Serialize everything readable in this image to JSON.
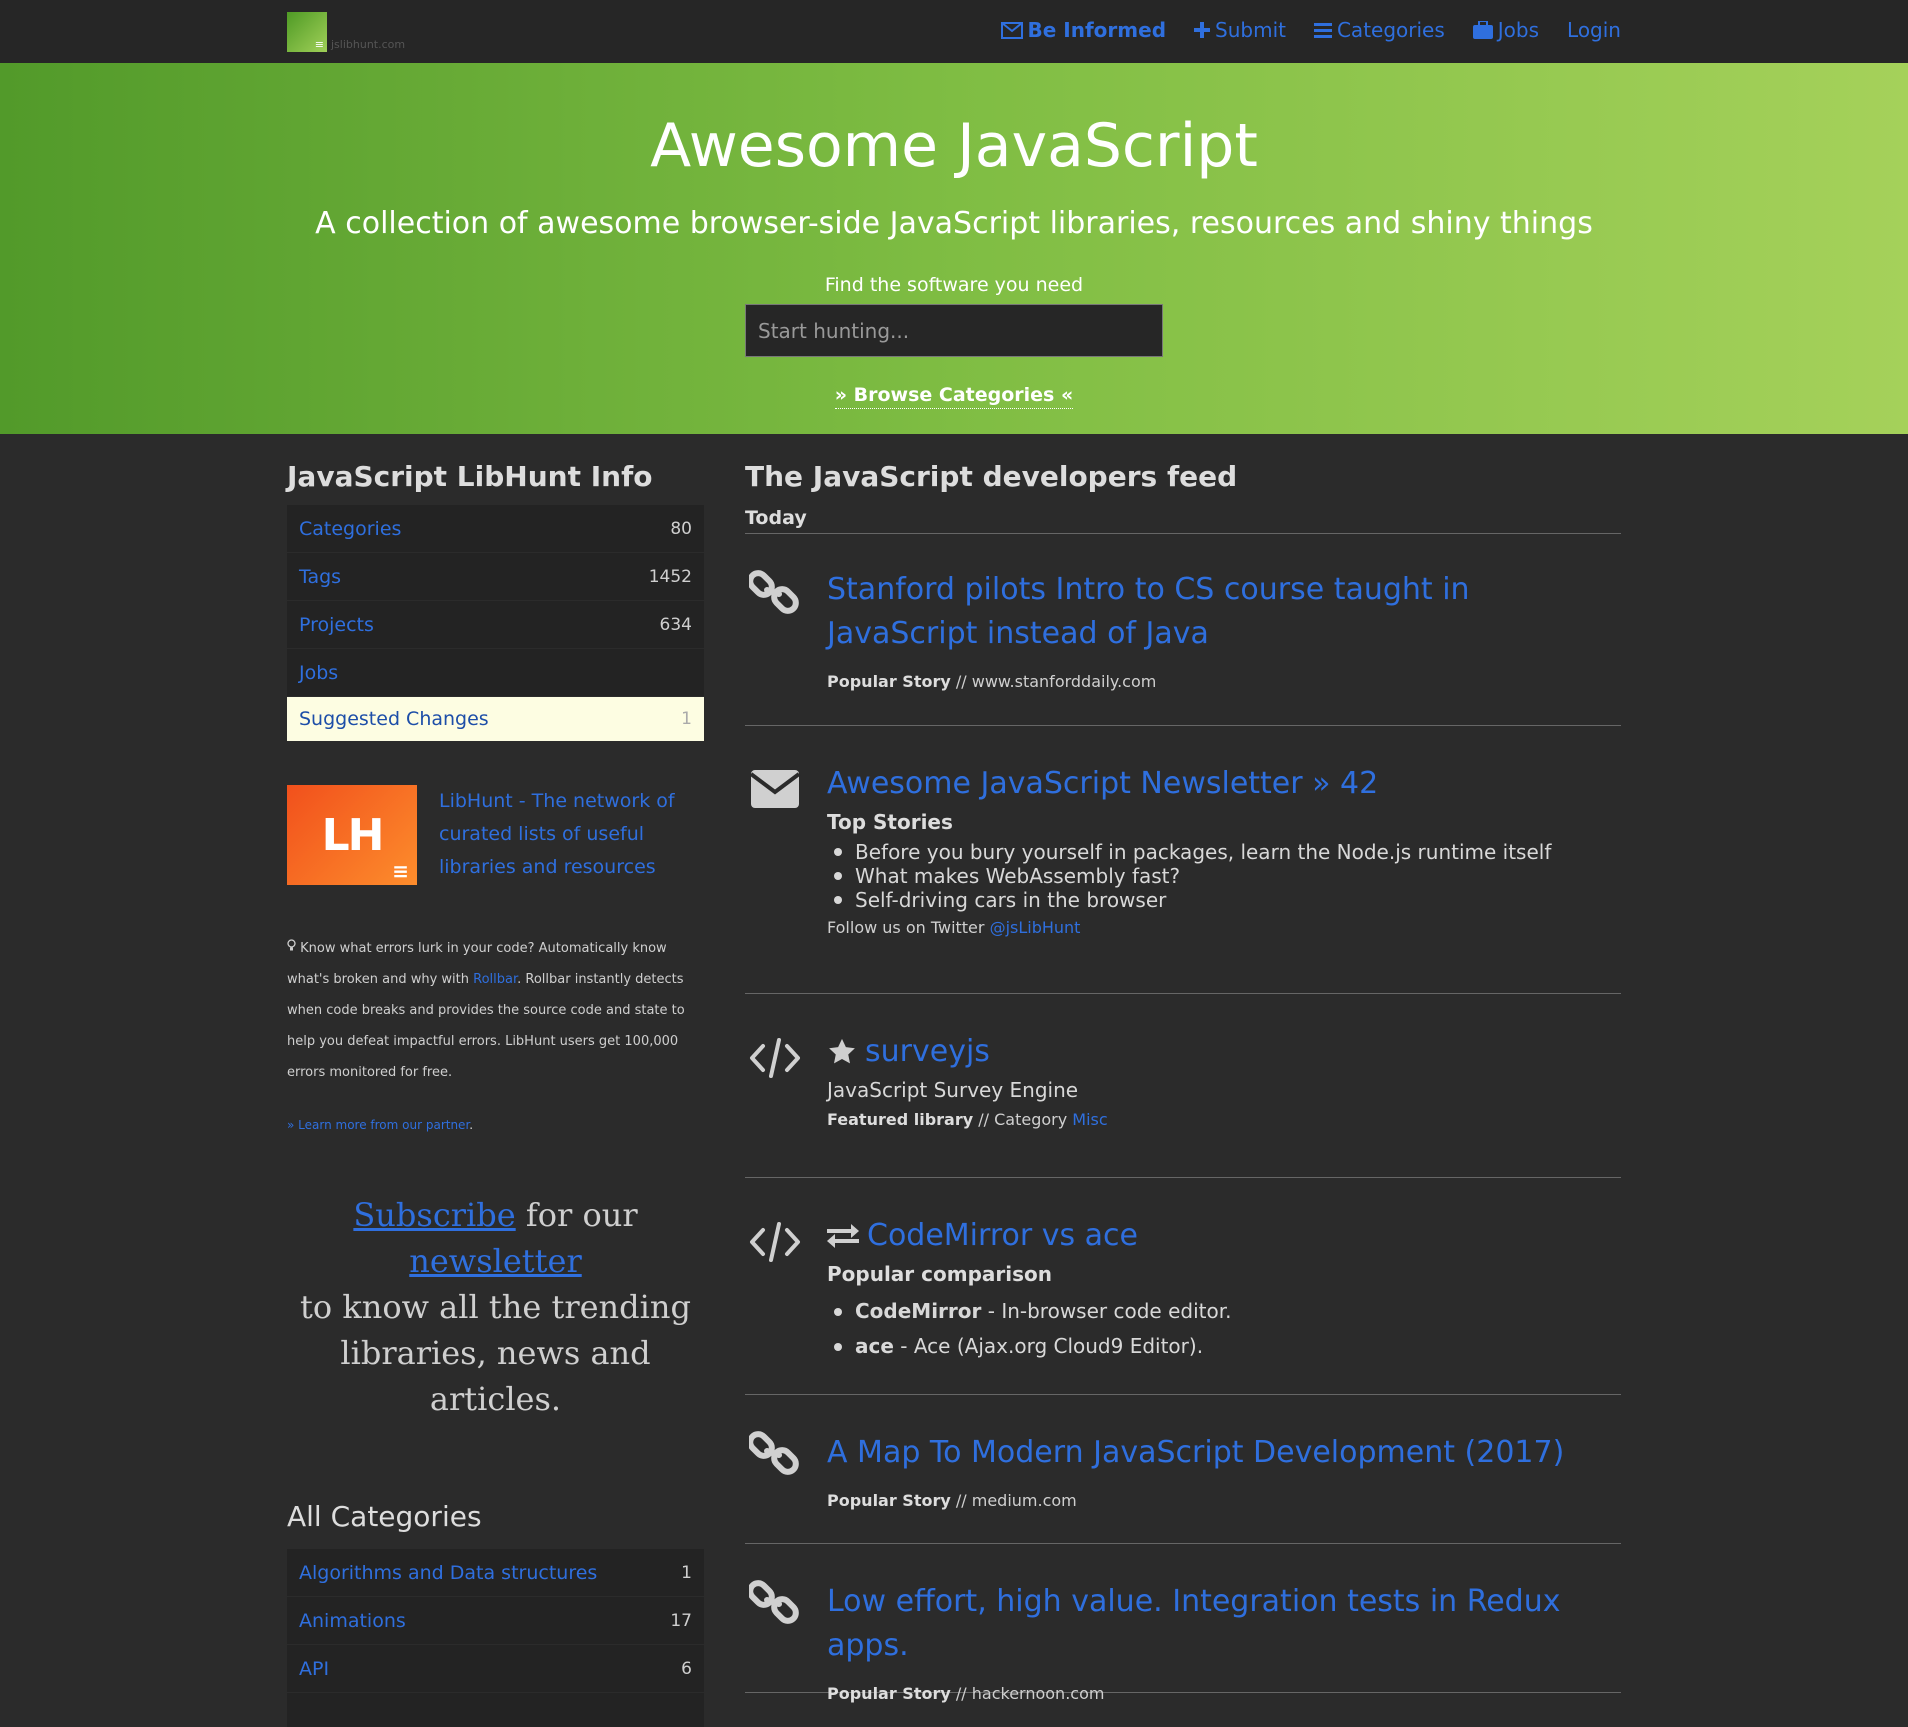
{
  "nav": {
    "logo_text": "jslibhunt.com",
    "links": [
      {
        "label": "Be Informed",
        "icon": "envelope-icon"
      },
      {
        "label": "Submit",
        "icon": "plus-icon"
      },
      {
        "label": "Categories",
        "icon": "list-icon"
      },
      {
        "label": "Jobs",
        "icon": "briefcase-icon"
      },
      {
        "label": "Login"
      }
    ]
  },
  "hero": {
    "title": "Awesome JavaScript",
    "subtitle": "A collection of awesome browser-side JavaScript libraries, resources and shiny things",
    "find_label": "Find the software you need",
    "search_placeholder": "Start hunting...",
    "browse_label": "» Browse Categories «"
  },
  "sidebar": {
    "info_title": "JavaScript LibHunt Info",
    "info_items": [
      {
        "label": "Categories",
        "count": "80"
      },
      {
        "label": "Tags",
        "count": "1452"
      },
      {
        "label": "Projects",
        "count": "634"
      },
      {
        "label": "Jobs",
        "count": ""
      },
      {
        "label": "Suggested Changes",
        "count": "1"
      }
    ],
    "lh_logo": "LH",
    "lh_text": "LibHunt - The network of curated lists of useful libraries and resources",
    "sponsor": {
      "before": " Know what errors lurk in your code? Automatically know what's broken and why with ",
      "link": "Rollbar",
      "after": ". Rollbar instantly detects when code breaks and provides the source code and state to help you defeat impactful errors. LibHunt users get 100,000 errors monitored for free."
    },
    "learn_more": "» Learn more from our partner",
    "subscribe": {
      "link1": "Subscribe",
      "mid": " for our ",
      "link2": "newsletter",
      "rest": "to know all the trending libraries, news and articles."
    },
    "all_categories_title": "All Categories",
    "categories": [
      {
        "label": "Algorithms and Data structures",
        "count": "1"
      },
      {
        "label": "Animations",
        "count": "17"
      },
      {
        "label": "API",
        "count": "6"
      }
    ]
  },
  "feed": {
    "title": "The JavaScript developers feed",
    "today_label": "Today",
    "story1": {
      "title": "Stanford pilots Intro to CS course taught in JavaScript instead of Java",
      "kind": "Popular Story",
      "source": " // www.stanforddaily.com"
    },
    "newsletter": {
      "title": "Awesome JavaScript Newsletter » 42",
      "subhead": "Top Stories",
      "items": [
        "Before you bury yourself in packages, learn the Node.js runtime itself",
        "What makes WebAssembly fast?",
        "Self-driving cars in the browser"
      ],
      "follow": "Follow us on Twitter ",
      "handle": "@jsLibHunt"
    },
    "featured": {
      "title": "surveyjs",
      "desc": "JavaScript Survey Engine",
      "kind": "Featured library",
      "cat_prefix": " // Category ",
      "category": "Misc"
    },
    "comparison": {
      "title": "CodeMirror vs ace",
      "subhead": "Popular comparison",
      "items": [
        {
          "name": "CodeMirror",
          "desc": " - In-browser code editor."
        },
        {
          "name": "ace",
          "desc": " - Ace (Ajax.org Cloud9 Editor)."
        }
      ]
    },
    "story2": {
      "title": "A Map To Modern JavaScript Development (2017)",
      "kind": "Popular Story",
      "source": " // medium.com"
    },
    "story3": {
      "title": "Low effort, high value. Integration tests in Redux apps.",
      "kind": "Popular Story",
      "source": " // hackernoon.com"
    }
  }
}
